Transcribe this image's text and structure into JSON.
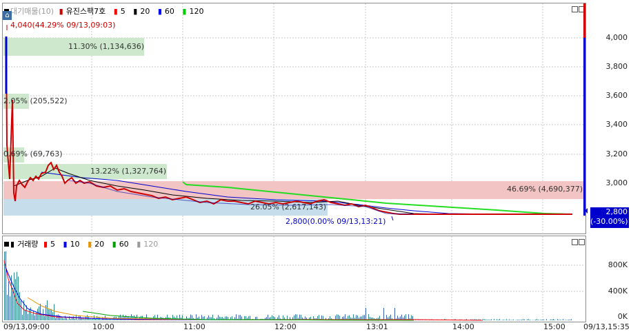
{
  "price_panel": {
    "legend": {
      "title": "대기매물(10)",
      "stock": "유진스팩7호",
      "ma": [
        "5",
        "20",
        "60",
        "120"
      ]
    },
    "y_ticks": [
      "4,000",
      "3,800",
      "3,600",
      "3,400",
      "3,200",
      "3,000"
    ],
    "high_label": "4,040(44.29% 09/13,09:03)",
    "low_label": "2,800(0.00% 09/13,13:21)",
    "current_price": "2,800",
    "current_change": "(-30.00%)",
    "zones": [
      {
        "label": "11.30% (1,134,636)",
        "color": "#cde8cd"
      },
      {
        "label": "2.05% (205,522)",
        "color": "#cde8cd"
      },
      {
        "label": "0.69% (69,763)",
        "color": "#cde8cd"
      },
      {
        "label": "13.22% (1,327,764)",
        "color": "#cde8cd"
      },
      {
        "label": "46.69% (4,690,377)",
        "color": "#f2c4c4"
      },
      {
        "label": "26.05% (2,617,143)",
        "color": "#c6deec"
      }
    ],
    "corner_icon": "home-icon"
  },
  "volume_panel": {
    "legend": {
      "title": "거래량",
      "ma": [
        "5",
        "10",
        "20",
        "60",
        "120"
      ]
    },
    "y_ticks": [
      "800K",
      "400K",
      "0K"
    ]
  },
  "x_axis": {
    "labels": [
      "09/13,09:00",
      "10:00",
      "11:00",
      "12:00",
      "13:01",
      "14:00",
      "15:00",
      "09/13,15:35"
    ]
  },
  "colors": {
    "ma5": "#ff0000",
    "ma20": "#000000",
    "ma60": "#0000ff",
    "ma120": "#00cc00",
    "price_line": "#cc0000",
    "current_bar": "#0000cc"
  },
  "chart_data": {
    "type": "line",
    "x": [
      "09:00",
      "09:03",
      "09:10",
      "09:20",
      "09:30",
      "09:40",
      "10:00",
      "10:30",
      "11:00",
      "11:30",
      "12:00",
      "12:30",
      "13:00",
      "13:21",
      "13:40",
      "14:00",
      "15:00",
      "15:30"
    ],
    "series": [
      {
        "name": "유진스팩7호",
        "values": [
          3950,
          4040,
          3000,
          3100,
          3150,
          3020,
          2980,
          2950,
          2900,
          2900,
          2880,
          2900,
          2860,
          2800,
          2810,
          2800,
          2800,
          2800
        ]
      }
    ],
    "ylim": [
      2800,
      4100
    ],
    "volume_ylim": [
      0,
      1000000
    ]
  }
}
